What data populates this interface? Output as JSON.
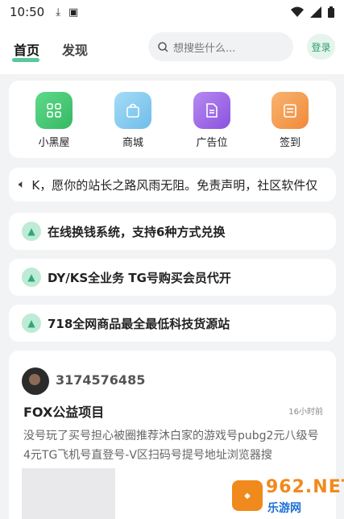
{
  "status_bar": {
    "time": "10:50"
  },
  "nav": {
    "tabs": [
      {
        "label": "首页",
        "active": true
      },
      {
        "label": "发现",
        "active": false
      }
    ],
    "search_placeholder": "想搜些什么...",
    "login_label": "登录"
  },
  "quick_actions": [
    {
      "label": "小黑屋",
      "icon": "grid-icon",
      "color": "#3cc46a"
    },
    {
      "label": "商城",
      "icon": "shopping-bag-icon",
      "color": "#7fc8ef"
    },
    {
      "label": "广告位",
      "icon": "document-icon",
      "color": "#9a63e8"
    },
    {
      "label": "签到",
      "icon": "calendar-icon",
      "color": "#f29a4a"
    }
  ],
  "notice": {
    "text": "K，愿你的站长之路风雨无阻。免责声明，社区软件仅"
  },
  "pinned_posts": [
    {
      "title": "在线换钱系统，支持6种方式兑换"
    },
    {
      "title": "DY/KS全业务 TG号购买会员代开"
    },
    {
      "title": "718全网商品最全最低科技货源站"
    }
  ],
  "post": {
    "username": "3174576485",
    "title": "FOX公益项目",
    "time": "16小时前",
    "body": "没号玩了买号担心被圈推荐沐白家的游戏号pubg2元八级号4元TG飞机号直登号-V区扫码号提号地址浏览器搜"
  },
  "watermark": {
    "big": "962.NET",
    "small": "乐游网"
  }
}
